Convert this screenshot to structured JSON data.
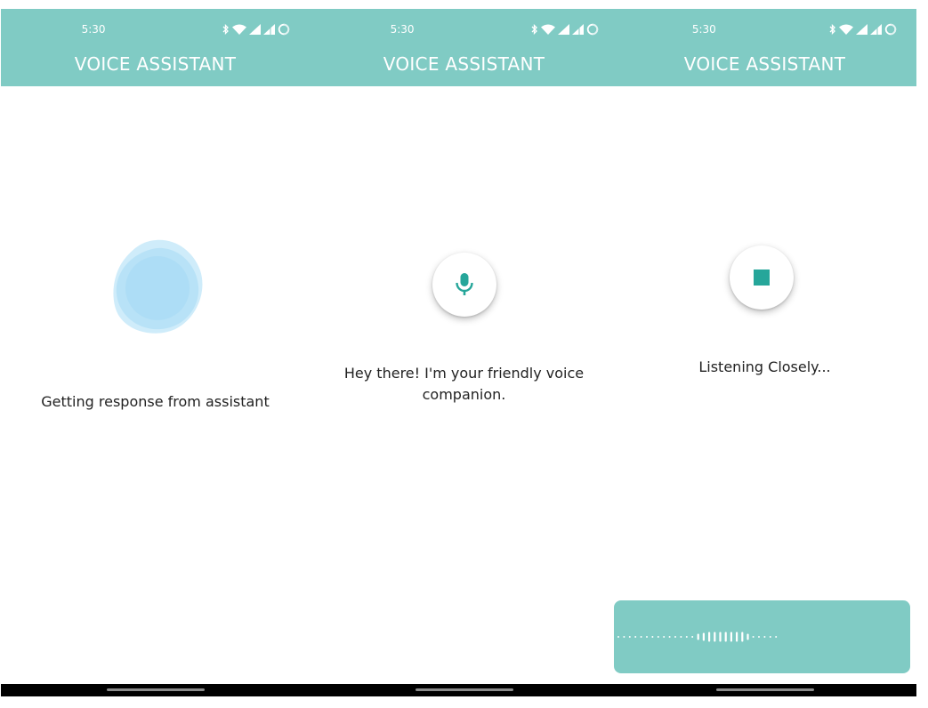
{
  "status_bar": {
    "time": "5:30",
    "icons": [
      "bluetooth-icon",
      "wifi-icon",
      "signal-icon",
      "signal-icon",
      "battery-icon"
    ]
  },
  "app": {
    "title": "VOICE ASSISTANT"
  },
  "screens": [
    {
      "state": "processing",
      "visual": "blob-animation",
      "message": "Getting response from assistant"
    },
    {
      "state": "idle",
      "button_icon": "microphone-icon",
      "message": "Hey there! I'm your friendly voice companion."
    },
    {
      "state": "listening",
      "button_icon": "stop-icon",
      "message": "Listening Closely...",
      "waveform_visible": true
    }
  ],
  "colors": {
    "appbar": "#80cbc4",
    "accent": "#26a69a",
    "blob": "#a8dcf5",
    "nav_bar": "#000000"
  }
}
